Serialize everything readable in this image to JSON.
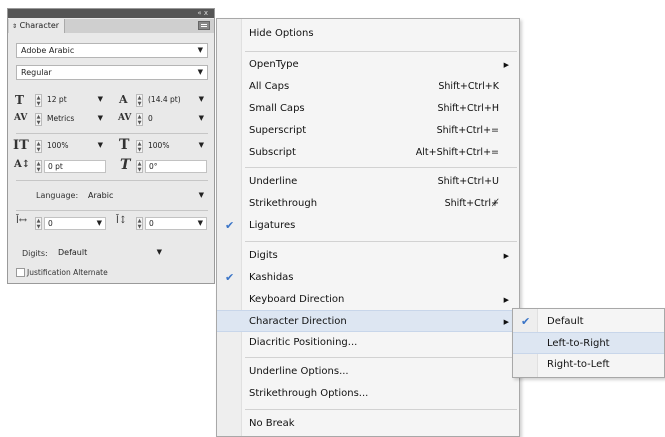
{
  "panel": {
    "tab_label": "Character",
    "tab_icon": "double-arrow-icon",
    "window_controls": "« x",
    "font_family": "Adobe Arabic",
    "font_style": "Regular",
    "font_size": "12 pt",
    "leading": "(14.4 pt)",
    "kerning": "Metrics",
    "tracking": "0",
    "vertical_scale": "100%",
    "horizontal_scale": "100%",
    "baseline_shift": "0 pt",
    "skew": "0°",
    "language_label": "Language:",
    "language_value": "Arabic",
    "diacritic_x": "0",
    "diacritic_y": "0",
    "digits_label": "Digits:",
    "digits_value": "Default",
    "justification_alternate": "Justification Alternate"
  },
  "menu": {
    "items": [
      {
        "label": "Hide Options"
      },
      {
        "label": "OpenType",
        "submenu": true
      },
      {
        "label": "All Caps",
        "shortcut": "Shift+Ctrl+K"
      },
      {
        "label": "Small Caps",
        "shortcut": "Shift+Ctrl+H"
      },
      {
        "label": "Superscript",
        "shortcut": "Shift+Ctrl+="
      },
      {
        "label": "Subscript",
        "shortcut": "Alt+Shift+Ctrl+="
      },
      {
        "label": "Underline",
        "shortcut": "Shift+Ctrl+U"
      },
      {
        "label": "Strikethrough",
        "shortcut": "Shift+Ctrl+̸"
      },
      {
        "label": "Ligatures",
        "checked": true
      },
      {
        "label": "Digits",
        "submenu": true
      },
      {
        "label": "Kashidas",
        "checked": true
      },
      {
        "label": "Keyboard Direction",
        "submenu": true
      },
      {
        "label": "Character Direction",
        "submenu": true,
        "highlighted": true
      },
      {
        "label": "Diacritic Positioning..."
      },
      {
        "label": "Underline Options..."
      },
      {
        "label": "Strikethrough Options..."
      },
      {
        "label": "No Break"
      }
    ]
  },
  "submenu": {
    "items": [
      {
        "label": "Default",
        "checked": true
      },
      {
        "label": "Left-to-Right",
        "highlighted": true
      },
      {
        "label": "Right-to-Left"
      }
    ]
  },
  "glyphs": {
    "check": "✔",
    "submenu_arrow": "▶",
    "dropdown_arrow": "▼"
  }
}
